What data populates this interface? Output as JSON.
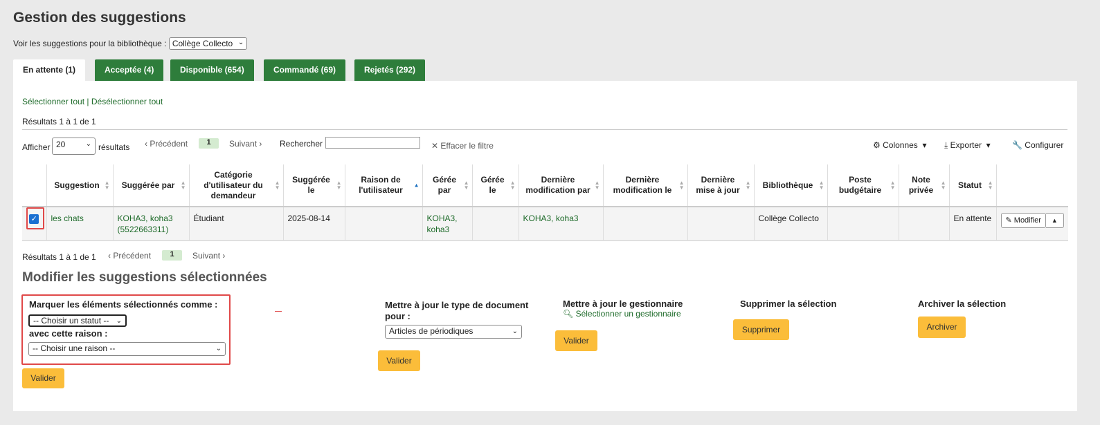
{
  "page": {
    "title": "Gestion des suggestions",
    "library_label": "Voir les suggestions pour la bibliothèque :",
    "library_value": "Collège Collecto"
  },
  "tabs": [
    {
      "label": "En attente (1)",
      "active": true
    },
    {
      "label": "Acceptée (4)"
    },
    {
      "label": "Disponible (654)"
    },
    {
      "label": "Commandé (69)"
    },
    {
      "label": "Rejetés (292)"
    }
  ],
  "selection": {
    "select_all": "Sélectionner tout",
    "separator": "|",
    "deselect_all": "Désélectionner tout"
  },
  "results_text": "Résultats 1 à 1 de 1",
  "pager": {
    "show_label": "Afficher",
    "show_value": "20",
    "results_label": "résultats",
    "prev": "Précédent",
    "page": "1",
    "next": "Suivant",
    "search_label": "Rechercher :",
    "search_value": "",
    "clear_filter": "Effacer le filtre"
  },
  "toolbar": {
    "columns": "Colonnes",
    "export": "Exporter",
    "configure": "Configurer"
  },
  "table": {
    "headers": [
      "Suggestion",
      "Suggérée par",
      "Catégorie d'utilisateur du demandeur",
      "Suggérée le",
      "Raison de l'utilisateur",
      "Gérée par",
      "Gérée le",
      "Dernière modification par",
      "Dernière modification le",
      "Dernière mise à jour",
      "Bibliothèque",
      "Poste budgétaire",
      "Note privée",
      "Statut"
    ],
    "row": {
      "suggestion": "les chats",
      "suggested_by": "KOHA3, koha3 (5522663311)",
      "category": "Étudiant",
      "suggested_on": "2025-08-14",
      "reason": "",
      "managed_by": "KOHA3, koha3",
      "managed_on": "",
      "last_modified_by": "KOHA3, koha3",
      "last_modified_on": "",
      "last_update": "",
      "library": "Collège Collecto",
      "budget": "",
      "note": "",
      "status": "En attente",
      "edit_label": "Modifier"
    }
  },
  "bulk": {
    "title": "Modifier les suggestions sélectionnées",
    "mark_label": "Marquer les éléments sélectionnés comme :",
    "status_select": "-- Choisir un statut --",
    "reason_label": "avec cette raison :",
    "reason_select": "-- Choisir une raison --",
    "validate": "Valider",
    "doc_type_title": "Mettre à jour le type de document pour :",
    "doc_type_value": "Articles de périodiques",
    "manager_title": "Mettre à jour le gestionnaire",
    "select_manager": "Sélectionner un gestionnaire",
    "delete_title": "Supprimer la sélection",
    "delete_button": "Supprimer",
    "archive_title": "Archiver la sélection",
    "archive_button": "Archiver"
  }
}
